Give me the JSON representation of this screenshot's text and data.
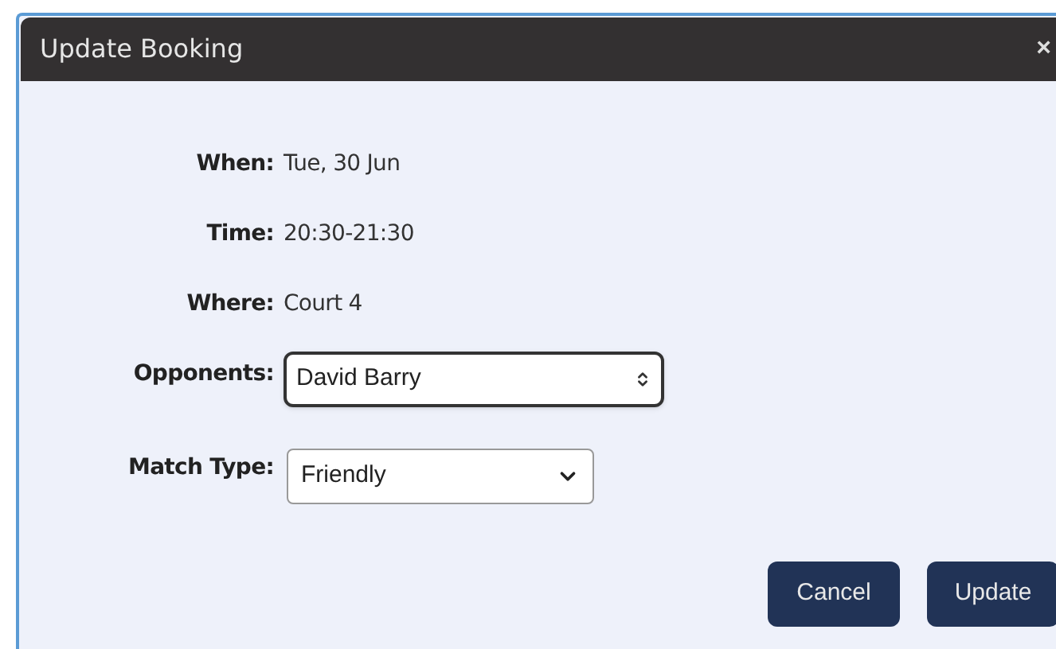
{
  "dialog": {
    "title": "Update Booking",
    "close": "×"
  },
  "details": [
    {
      "label": "When:",
      "value": "Tue, 30 Jun"
    },
    {
      "label": "Time:",
      "value": "20:30-21:30"
    },
    {
      "label": "Where:",
      "value": "Court 4"
    }
  ],
  "fields": [
    {
      "label": "Opponents:",
      "value": "David Barry",
      "focused": true
    },
    {
      "label": "Match Type:",
      "value": "Friendly",
      "focused": false
    }
  ],
  "buttons": [
    "Cancel",
    "Update"
  ]
}
